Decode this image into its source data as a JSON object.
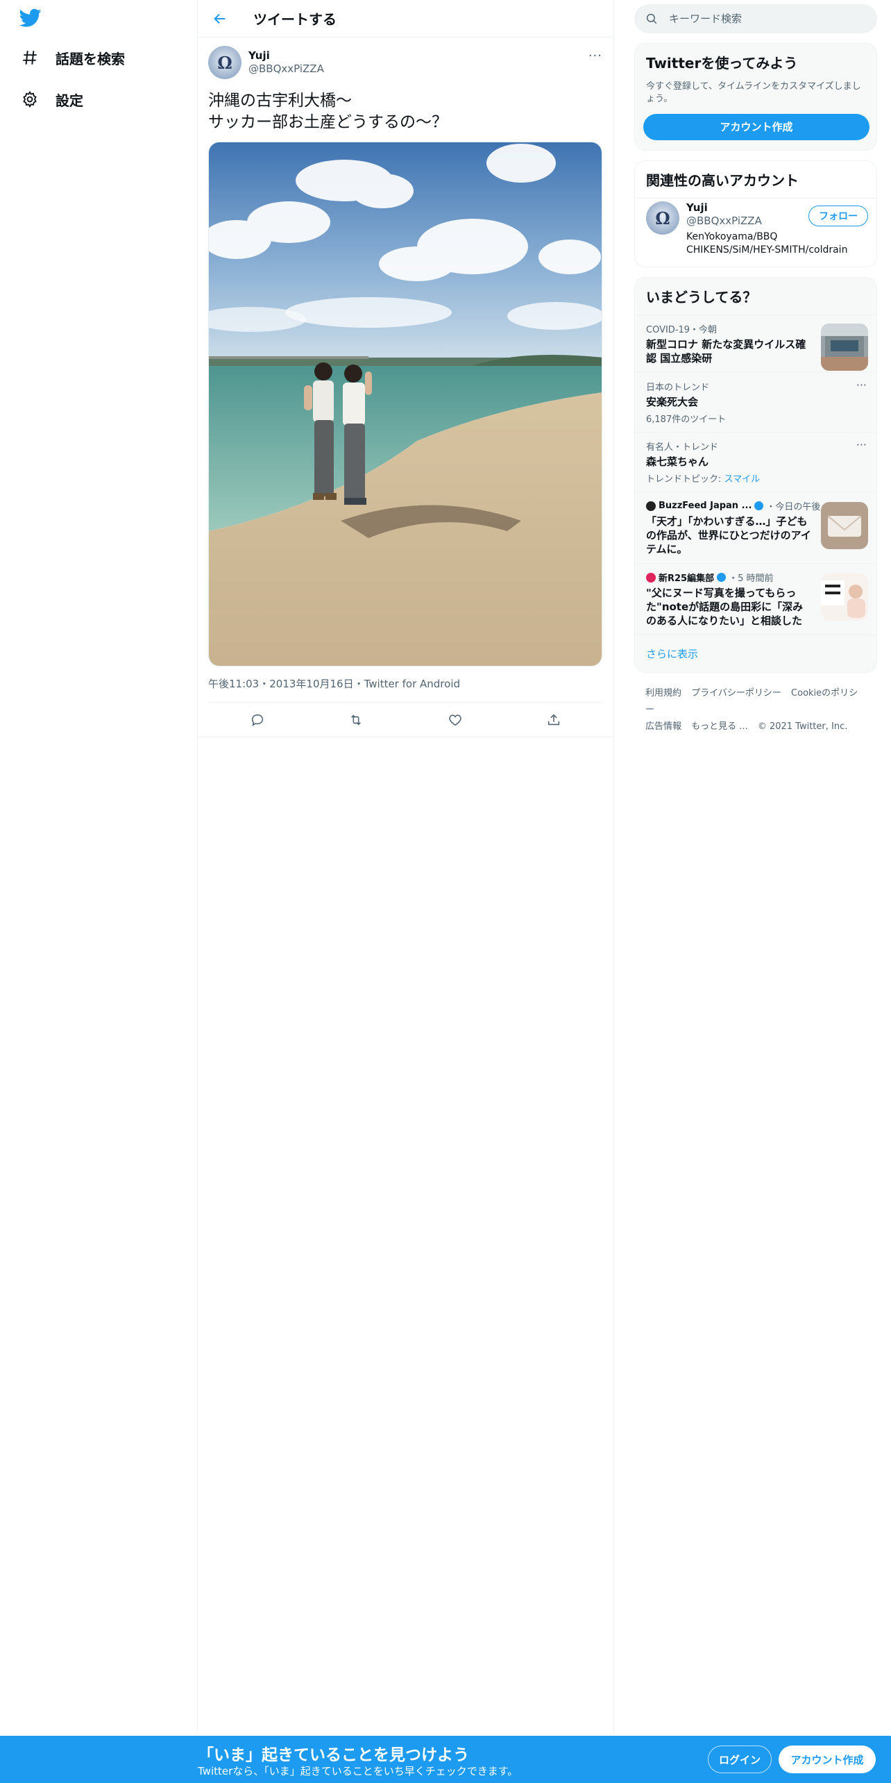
{
  "nav": {
    "logo": "twitter-bird-icon",
    "items": [
      {
        "label": "話題を検索",
        "icon": "hashtag-icon"
      },
      {
        "label": "設定",
        "icon": "gear-icon"
      }
    ]
  },
  "header": {
    "title": "ツイートする",
    "back_icon": "arrow-left-icon"
  },
  "tweet": {
    "display_name": "Yuji",
    "handle": "@BBQxxPiZZA",
    "more": "···",
    "text": "沖縄の古宇利大橋〜\nサッカー部お土産どうするの〜？",
    "meta": "午後11:03・2013年10月16日・Twitter for Android",
    "actions": [
      "reply-icon",
      "retweet-icon",
      "like-icon",
      "share-icon"
    ]
  },
  "search": {
    "placeholder": "キーワード検索"
  },
  "signup_card": {
    "title": "Twitterを使ってみよう",
    "desc": "今すぐ登録して、タイムラインをカスタマイズしましょう。",
    "button": "アカウント作成"
  },
  "related": {
    "title": "関連性の高いアカウント",
    "name": "Yuji",
    "handle": "@BBQxxPiZZA",
    "bio": "KenYokoyama/BBQ CHIKENS/SiM/HEY-SMITH/coldrain",
    "follow": "フォロー"
  },
  "trends": {
    "title": "いまどうしてる？",
    "items": [
      {
        "context": "COVID-19・今朝",
        "title": "新型コロナ 新たな変異ウイルス確認 国立感染研"
      },
      {
        "context": "日本のトレンド",
        "title": "安楽死大会",
        "sub": "6,187件のツイート"
      },
      {
        "context": "有名人・トレンド",
        "title": "森七菜ちゃん",
        "sub_prefix": "トレンドトピック: ",
        "sub_link": "スマイル"
      },
      {
        "context_source": "BuzzFeed Japan ...",
        "context_time": "・今日の午後",
        "title": "「天才」「かわいすぎる…」子どもの作品が、世界にひとつだけのアイテムに。"
      },
      {
        "context_source": "新R25編集部",
        "context_time": "・5 時間前",
        "title": "\"父にヌード写真を撮ってもらった\"noteが話題の島田彩に「深みのある人になりたい」と相談した"
      }
    ],
    "show_more": "さらに表示"
  },
  "footer": {
    "links": [
      "利用規約",
      "プライバシーポリシー",
      "Cookieのポリシー",
      "広告情報",
      "もっと見る ...",
      "© 2021 Twitter, Inc."
    ]
  },
  "bottombar": {
    "title": "「いま」起きていることを見つけよう",
    "subtitle": "Twitterなら、「いま」起きていることをいち早くチェックできます。",
    "login": "ログイン",
    "signup": "アカウント作成"
  },
  "colors": {
    "accent": "#1d9bf0",
    "text": "#0f1419",
    "muted": "#536471"
  }
}
